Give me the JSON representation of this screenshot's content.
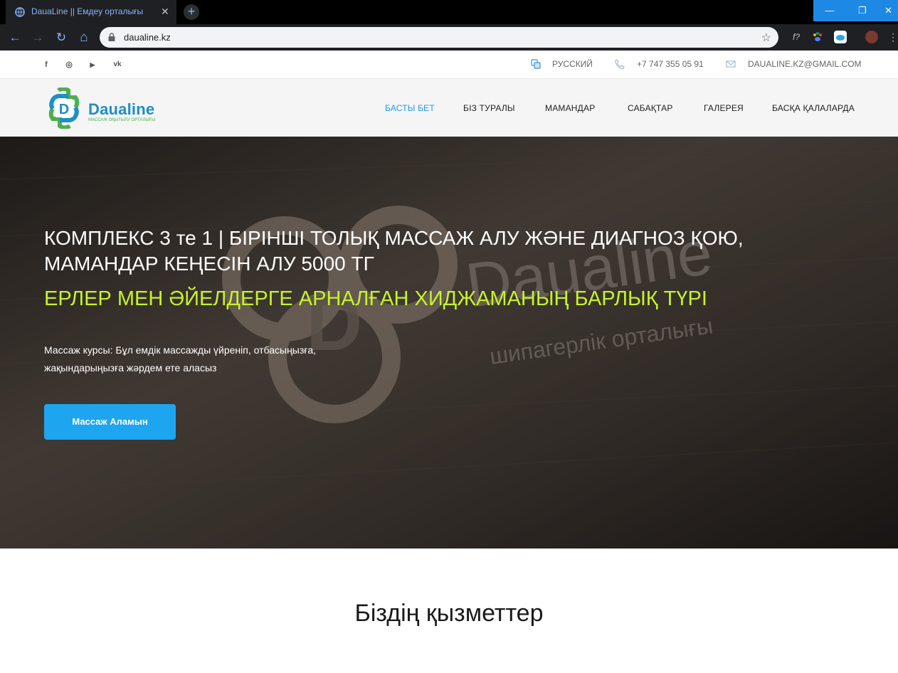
{
  "browser": {
    "tab_title": "DauaLine || Емдеу орталығы",
    "tab_close": "✕",
    "new_tab": "+",
    "url": "daualine.kz",
    "window_min": "—",
    "window_max": "❐",
    "window_close": "✕",
    "back_icon": "←",
    "forward_icon": "→",
    "reload_icon": "↻",
    "home_icon": "⌂",
    "star_icon": "☆",
    "extension_f": "f?"
  },
  "topbar": {
    "social": [
      {
        "name": "facebook-icon",
        "glyph": "f"
      },
      {
        "name": "instagram-icon",
        "glyph": "◎"
      },
      {
        "name": "youtube-icon",
        "glyph": "▶"
      },
      {
        "name": "vk-icon",
        "glyph": "vk"
      }
    ],
    "language": "РУССКИЙ",
    "phone": "+7 747 355 05 91",
    "email": "DAUALINE.KZ@GMAIL.COM"
  },
  "logo": {
    "letter": "D",
    "name": "Daualine",
    "tagline": "МАССАЖ ОҚЫТЫЛУ ОРТАЛЫҒЫ"
  },
  "nav": {
    "items": [
      {
        "label": "БАСТЫ БЕТ",
        "active": true
      },
      {
        "label": "БІЗ ТУРАЛЫ",
        "active": false
      },
      {
        "label": "МАМАНДАР",
        "active": false
      },
      {
        "label": "САБАҚТАР",
        "active": false
      },
      {
        "label": "ГАЛЕРЕЯ",
        "active": false
      },
      {
        "label": "БАСҚА ҚАЛАЛАРДА",
        "active": false
      }
    ]
  },
  "hero": {
    "title": "КОМПЛЕКС 3 те 1 | БІРІНШІ ТОЛЫҚ МАССАЖ АЛУ ЖӘНЕ ДИАГНОЗ ҚОЮ, МАМАНДАР КЕҢЕСІН АЛУ 5000 ТГ",
    "subtitle": "ЕРЛЕР МЕН ӘЙЕЛДЕРГЕ АРНАЛҒАН ХИДЖАМАНЫҢ БАРЛЫҚ ТҮРІ",
    "text": "Массаж курсы: Бұл емдік массажды үйреніп, отбасыңызға, жақындарыңызға жәрдем ете аласыз",
    "button": "Массаж Аламын",
    "sign_name": "Daualine",
    "sign_tagline": "шипагерлік орталығы"
  },
  "services": {
    "title": "Біздің қызметтер"
  },
  "colors": {
    "accent": "#2196f3",
    "button": "#1ea5f0",
    "subtitle": "#c6f22a",
    "logo_blue": "#1d8fc8",
    "logo_green": "#4caf50"
  }
}
